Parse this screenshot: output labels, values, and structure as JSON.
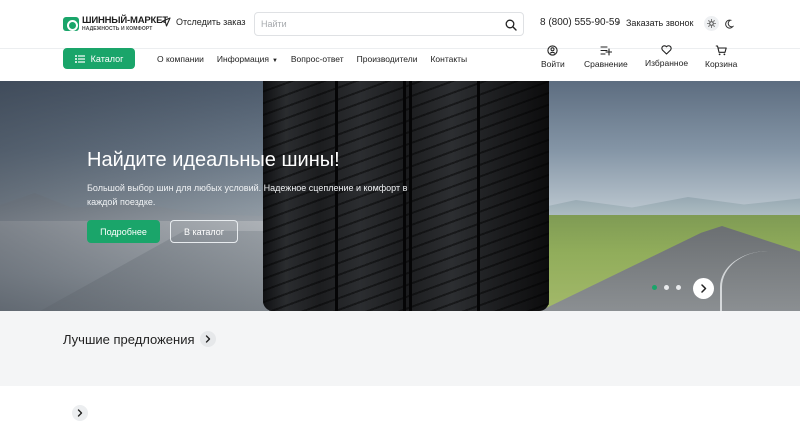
{
  "brand": {
    "name": "ШИННЫЙ-МАРКЕТ",
    "tagline": "НАДЕЖНОСТЬ И КОМФОРТ",
    "accent_color": "#1aa56a"
  },
  "header": {
    "track_order_label": "Отследить заказ",
    "search_placeholder": "Найти",
    "phone": "8 (800) 555-90-59",
    "callback_label": "Заказать звонок"
  },
  "nav": {
    "catalog_label": "Каталог",
    "items": [
      {
        "label": "О компании",
        "has_dropdown": false
      },
      {
        "label": "Информация",
        "has_dropdown": true
      },
      {
        "label": "Вопрос-ответ",
        "has_dropdown": false
      },
      {
        "label": "Производители",
        "has_dropdown": false
      },
      {
        "label": "Контакты",
        "has_dropdown": false
      }
    ]
  },
  "actions": {
    "login": "Войти",
    "compare": "Сравнение",
    "favorites": "Избранное",
    "cart": "Корзина"
  },
  "hero": {
    "title": "Найдите идеальные шины!",
    "text": "Большой выбор шин для любых условий. Надежное сцепление и комфорт в каждой поездке.",
    "primary_button": "Подробнее",
    "secondary_button": "В каталог",
    "slides_total": 3,
    "active_slide": 1
  },
  "offers": {
    "title": "Лучшие предложения"
  },
  "icons": {
    "track": "navigation-arrow-icon",
    "search": "search-icon",
    "theme_light": "sun-icon",
    "theme_dark": "moon-icon",
    "catalog": "list-icon",
    "login": "user-icon",
    "compare": "compare-icon",
    "favorites": "heart-icon",
    "cart": "cart-icon",
    "next": "chevron-right-icon"
  }
}
